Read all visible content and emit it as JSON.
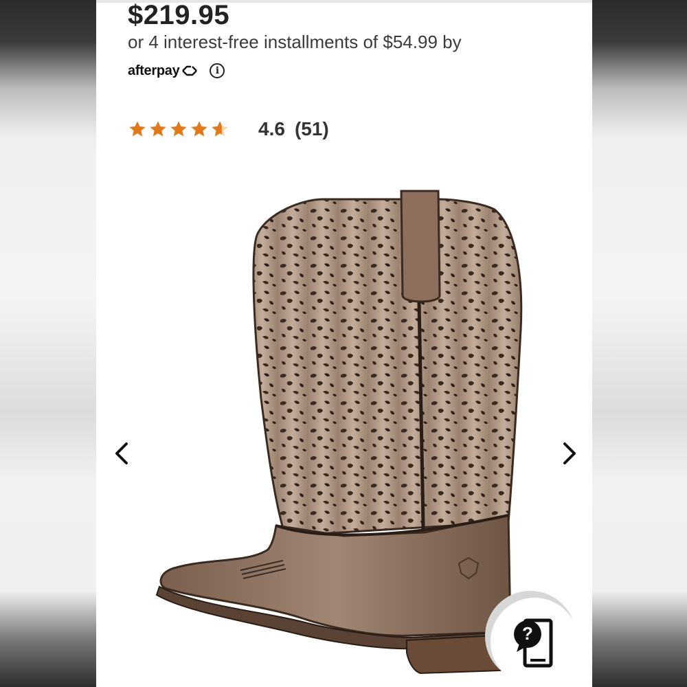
{
  "product": {
    "price": "$219.95",
    "installments_text": "or 4 interest-free installments of $54.99 by",
    "afterpay_label": "afterpay",
    "info_glyph": "i"
  },
  "rating": {
    "stars_value": 4.6,
    "score": "4.6",
    "count": "(51)",
    "star_color": "#e07a1a"
  },
  "gallery": {
    "prev_icon": "chevron-left-icon",
    "next_icon": "chevron-right-icon"
  },
  "help": {
    "icon": "help-phone-icon",
    "glyph": "?"
  }
}
